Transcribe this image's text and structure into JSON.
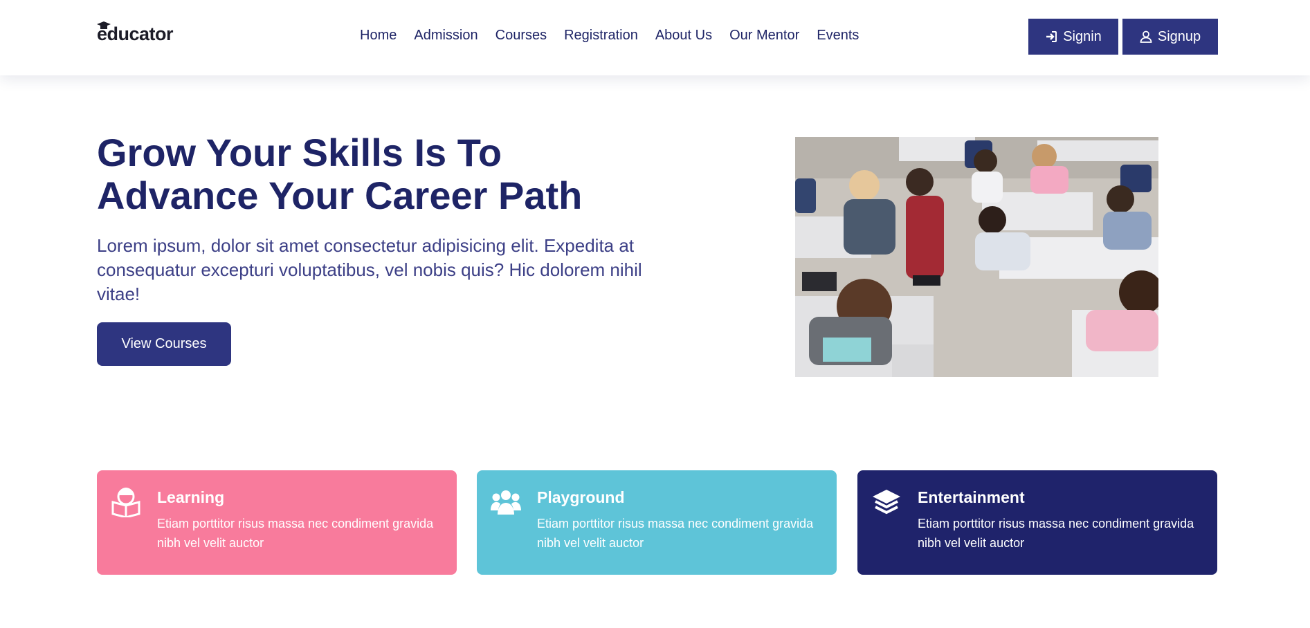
{
  "brand": {
    "name": "educator"
  },
  "nav": {
    "items": [
      "Home",
      "Admission",
      "Courses",
      "Registration",
      "About Us",
      "Our Mentor",
      "Events"
    ]
  },
  "auth": {
    "signin_label": "Signin",
    "signup_label": "Signup"
  },
  "hero": {
    "title_line1": "Grow Your Skills Is To",
    "title_line2": "Advance Your Career Path",
    "text": "Lorem ipsum, dolor sit amet consectetur adipisicing elit. Expedita at consequatur excepturi voluptatibus, vel nobis quis? Hic dolorem nihil vitae!",
    "cta_label": "View Courses"
  },
  "features": [
    {
      "title": "Learning",
      "description": "Etiam porttitor risus massa nec condiment gravida nibh vel velit auctor",
      "icon": "reading-student-icon",
      "color": "#f87b9c"
    },
    {
      "title": "Playground",
      "description": "Etiam porttitor risus massa nec condiment gravida nibh vel velit auctor",
      "icon": "group-users-icon",
      "color": "#5ec4d8"
    },
    {
      "title": "Entertainment",
      "description": "Etiam porttitor risus massa nec condiment gravida nibh vel velit auctor",
      "icon": "layers-icon",
      "color": "#1f236b"
    }
  ],
  "colors": {
    "primary": "#2e3580",
    "heading": "#1e2466",
    "body_text": "#3c3f86"
  }
}
